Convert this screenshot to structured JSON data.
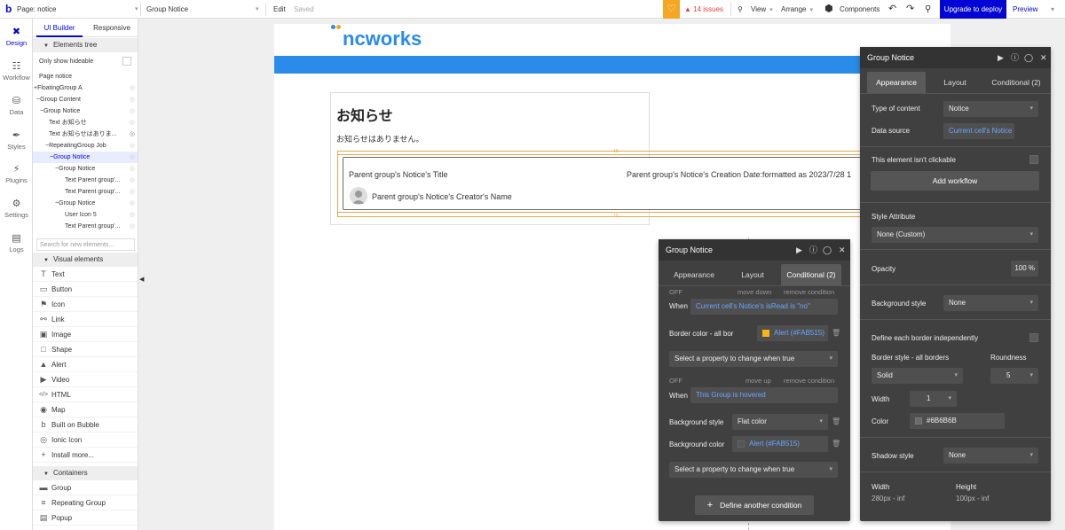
{
  "topbar": {
    "page_label": "Page: notice",
    "element_selector": "Group Notice",
    "edit": "Edit",
    "saved": "Saved",
    "issues": "14 issues",
    "view": "View",
    "arrange": "Arrange",
    "components": "Components",
    "upgrade": "Upgrade to deploy",
    "preview": "Preview"
  },
  "leftnav": [
    {
      "label": "Design",
      "icon": "design-icon"
    },
    {
      "label": "Workflow",
      "icon": "workflow-icon"
    },
    {
      "label": "Data",
      "icon": "data-icon"
    },
    {
      "label": "Styles",
      "icon": "styles-icon"
    },
    {
      "label": "Plugins",
      "icon": "plugins-icon"
    },
    {
      "label": "Settings",
      "icon": "settings-icon"
    },
    {
      "label": "Logs",
      "icon": "logs-icon"
    }
  ],
  "elpanel": {
    "tab_builder": "UI Builder",
    "tab_responsive": "Responsive",
    "elements_tree": "Elements tree",
    "only_hideable": "Only show hideable",
    "tree": [
      "Page notice",
      "+FloatingGroup A",
      "−Group Content",
      "−Group Notice",
      "Text お知らせ",
      "Text お知らせはありま...",
      "−RepeatingGroup Job",
      "−Group Notice",
      "−Group Notice",
      "Text Parent group'...",
      "Text Parent group'...",
      "−Group Notice",
      "User Icon 5",
      "Text Parent group'..."
    ],
    "search_placeholder": "Search for new elements...",
    "visual_elements": "Visual elements",
    "visual": [
      {
        "label": "Text",
        "icon": "T"
      },
      {
        "label": "Button",
        "icon": "▭"
      },
      {
        "label": "Icon",
        "icon": "⚑"
      },
      {
        "label": "Link",
        "icon": "⚯"
      },
      {
        "label": "Image",
        "icon": "▣"
      },
      {
        "label": "Shape",
        "icon": "□"
      },
      {
        "label": "Alert",
        "icon": "▲"
      },
      {
        "label": "Video",
        "icon": "▶"
      },
      {
        "label": "HTML",
        "icon": "</>"
      },
      {
        "label": "Map",
        "icon": "◉"
      },
      {
        "label": "Built on Bubble",
        "icon": "b"
      },
      {
        "label": "Ionic Icon",
        "icon": "◎"
      },
      {
        "label": "Install more...",
        "icon": "+"
      }
    ],
    "containers": "Containers",
    "container_items": [
      {
        "label": "Group",
        "icon": "▬"
      },
      {
        "label": "Repeating Group",
        "icon": "≡"
      },
      {
        "label": "Popup",
        "icon": "▤"
      }
    ]
  },
  "canvas": {
    "logo": "ncworks",
    "title": "お知らせ",
    "empty_msg": "お知らせはありません。",
    "notice_title": "Parent group's Notice's Title",
    "notice_date": "Parent group's Notice's Creation Date:formatted as 2023/7/28 1",
    "notice_creator": "Parent group's Notice's Creator's Name",
    "margin_top": "10",
    "margin_bottom": "10"
  },
  "panel_cond": {
    "title": "Group Notice",
    "tabs": [
      "Appearance",
      "Layout",
      "Conditional (2)"
    ],
    "off1": "OFF",
    "move_down": "move down",
    "remove1": "remove condition",
    "when_label": "When",
    "when1": "Current cell's Notice's isRead is \"no\"",
    "prop1_label": "Border color - all bor",
    "prop1_value": "Alert (#FAB515)",
    "select_prop": "Select a property to change when true",
    "off2": "OFF",
    "move_up": "move up",
    "remove2": "remove condition",
    "when2": "This Group is hovered",
    "bg_style_label": "Background style",
    "bg_style_value": "Flat color",
    "bg_color_label": "Background color",
    "bg_color_value": "Alert (#FAB515)",
    "select_prop2": "Select a property to change when true",
    "define": "Define another condition"
  },
  "panel_app": {
    "title": "Group Notice",
    "tabs": [
      "Appearance",
      "Layout",
      "Conditional (2)"
    ],
    "type_label": "Type of content",
    "type_value": "Notice",
    "ds_label": "Data source",
    "ds_value": "Current cell's Notice",
    "not_clickable": "This element isn't clickable",
    "add_workflow": "Add workflow",
    "style_attr": "Style Attribute",
    "style_value": "None (Custom)",
    "opacity_label": "Opacity",
    "opacity_value": "100 %",
    "bg_style_label": "Background style",
    "bg_style_value": "None",
    "border_indep": "Define each border independently",
    "border_style_label": "Border style - all borders",
    "roundness_label": "Roundness",
    "border_style_value": "Solid",
    "roundness_value": "5",
    "width_label": "Width",
    "width_value": "1",
    "color_label": "Color",
    "color_value": "#6B6B6B",
    "shadow_label": "Shadow style",
    "shadow_value": "None",
    "w_label": "Width",
    "w_value": "280px - inf",
    "h_label": "Height",
    "h_value": "100px - inf"
  },
  "colors": {
    "brand": "#0205d3",
    "alert": "#FAB515",
    "border": "#6B6B6B",
    "blue_bar": "#2b8be8"
  }
}
